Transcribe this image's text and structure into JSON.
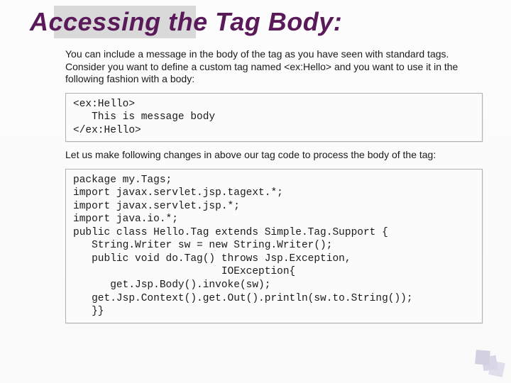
{
  "title": "Accessing the Tag Body:",
  "intro": "You can include a message in the body of the tag as you have seen with standard tags. Consider you want to define a custom tag named <ex:Hello> and you want to use it in the following fashion with a body:",
  "code1": "<ex:Hello>\n   This is message body\n</ex:Hello>",
  "mid": "Let us make following changes in above our tag code to process the body of the tag:",
  "code2": "package my.Tags;\nimport javax.servlet.jsp.tagext.*;\nimport javax.servlet.jsp.*;\nimport java.io.*;\npublic class Hello.Tag extends Simple.Tag.Support {\n   String.Writer sw = new String.Writer();\n   public void do.Tag() throws Jsp.Exception,\n                        IOException{\n      get.Jsp.Body().invoke(sw);\n   get.Jsp.Context().get.Out().println(sw.to.String());\n   }}"
}
